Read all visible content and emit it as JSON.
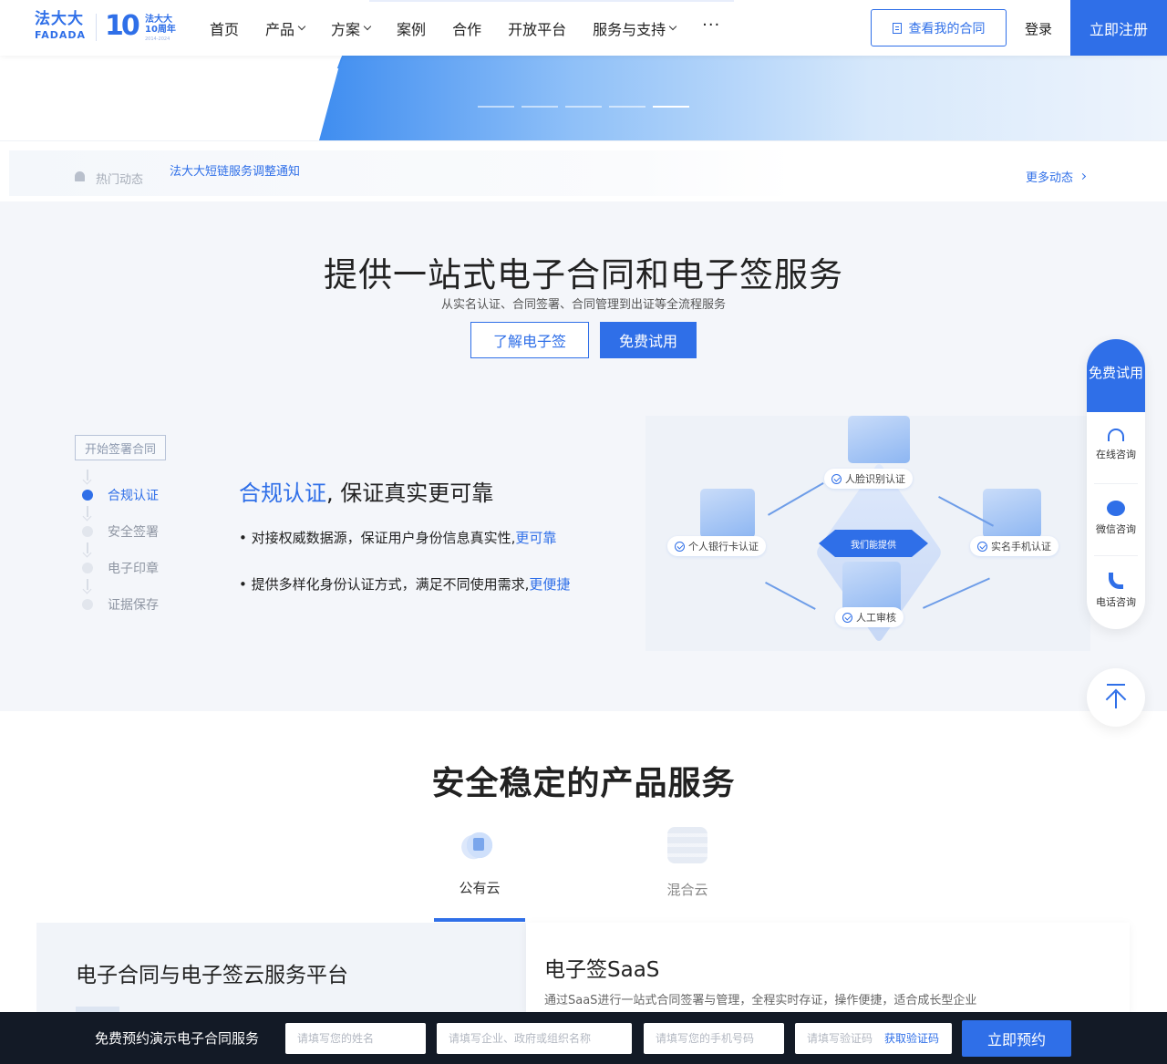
{
  "nav": {
    "logo_cn": "法大大",
    "logo_en": "FADADA",
    "anni_line1": "法大大",
    "anni_line2": "10周年",
    "anni_years": "2014-2024",
    "ten": "10",
    "menu": [
      {
        "label": "首页",
        "has_dropdown": false
      },
      {
        "label": "产品",
        "has_dropdown": true
      },
      {
        "label": "方案",
        "has_dropdown": true
      },
      {
        "label": "案例",
        "has_dropdown": false
      },
      {
        "label": "合作",
        "has_dropdown": false
      },
      {
        "label": "开放平台",
        "has_dropdown": false
      },
      {
        "label": "服务与支持",
        "has_dropdown": true
      }
    ],
    "more": "···",
    "view_contract": "查看我的合同",
    "login": "登录",
    "register": "立即注册"
  },
  "news": {
    "label": "热门动态",
    "item": "法大大短链服务调整通知",
    "more": "更多动态"
  },
  "onestop": {
    "title": "提供一站式电子合同和电子签服务",
    "subtitle": "从实名认证、合同签署、合同管理到出证等全流程服务",
    "learn_button": "了解电子签",
    "trial_button": "免费试用",
    "steps_head": "开始签署合同",
    "steps": [
      "合规认证",
      "安全签署",
      "电子印章",
      "证据保存"
    ],
    "active_step": 0,
    "feature_title_hl": "合规认证",
    "feature_title_rest": ", 保证真实更可靠",
    "feature_lines": [
      {
        "text": "• 对接权威数据源，保证用户身份信息真实性,",
        "link": "更可靠"
      },
      {
        "text": "• 提供多样化身份认证方式，满足不同使用需求,",
        "link": "更便捷"
      }
    ],
    "illustration": {
      "center": "我们能提供",
      "face": "人脸识别认证",
      "bank": "个人银行卡认证",
      "phone": "实名手机认证",
      "manual": "人工审核"
    }
  },
  "float": {
    "top": "免费试用",
    "items": [
      {
        "label": "在线咨询",
        "icon": "headset-icon"
      },
      {
        "label": "微信咨询",
        "icon": "chat-icon"
      },
      {
        "label": "电话咨询",
        "icon": "phone-icon"
      }
    ]
  },
  "product": {
    "title": "安全稳定的产品服务",
    "tabs": [
      {
        "label": "公有云",
        "active": true
      },
      {
        "label": "混合云",
        "active": false
      }
    ],
    "card_left_title": "电子合同与电子签云服务平台",
    "card_right_title": "电子签SaaS",
    "card_right_desc": "通过SaaS进行一站式合同签署与管理，全程实时存证，操作便捷，适合成长型企业"
  },
  "bottombar": {
    "label": "免费预约演示电子合同服务",
    "name_placeholder": "请填写您的姓名",
    "company_placeholder": "请填写企业、政府或组织名称",
    "phone_placeholder": "请填写您的手机号码",
    "code_placeholder": "请填写验证码",
    "get_code": "获取验证码",
    "book": "立即预约"
  },
  "colors": {
    "brand": "#2f6fe8",
    "dark_bar": "#131a26",
    "section_bg": "#f4f6fa"
  }
}
